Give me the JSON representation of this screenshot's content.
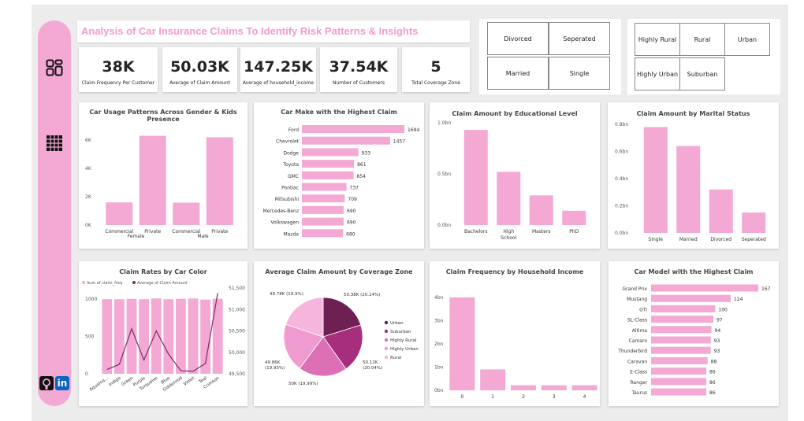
{
  "colors": {
    "accent": "#f29ccd",
    "bar": "#f4a8d4",
    "line": "#7b2b62",
    "sidebar": "#f4a8d4",
    "canvas": "#ececec"
  },
  "sidebar": {
    "icons": [
      {
        "name": "dashboard-grid-icon"
      },
      {
        "name": "table-grid-icon"
      }
    ],
    "social": [
      {
        "name": "github-icon"
      },
      {
        "name": "linkedin-icon",
        "label": "in"
      }
    ]
  },
  "header": {
    "title": "Analysis of Car Insurance  Claims To Identify Risk Patterns & Insights"
  },
  "kpis": [
    {
      "value": "38K",
      "label": "Claim Frequency Per Customer"
    },
    {
      "value": "50.03K",
      "label": "Average of Claim Amount"
    },
    {
      "value": "147.25K",
      "label": "Average of household_income"
    },
    {
      "value": "37.54K",
      "label": "Number of Customers"
    },
    {
      "value": "5",
      "label": "Total Coverage Zone"
    }
  ],
  "slicers": {
    "marital": [
      "Divorced",
      "Seperated",
      "Married",
      "Single"
    ],
    "zone": [
      "Highly Rural",
      "Rural",
      "Urban",
      "Highly Urban",
      "Suburban"
    ]
  },
  "chart_data": [
    {
      "id": "usage",
      "type": "bar",
      "title": "Car Usage Patterns Across Gender & Kids Presence",
      "categories": [
        "Commercial",
        "Private",
        "Commercial",
        "Private"
      ],
      "groups": [
        "Female",
        "Male"
      ],
      "values": [
        1600,
        6300,
        1580,
        6200
      ],
      "yticks": [
        "0K",
        "2K",
        "4K",
        "6K"
      ],
      "ylim": [
        0,
        7000
      ]
    },
    {
      "id": "make",
      "type": "bar",
      "orientation": "horizontal",
      "title": "Car Make with the Highest Claim",
      "categories": [
        "Ford",
        "Chevrolet",
        "Dodge",
        "Toyota",
        "GMC",
        "Pontiac",
        "Mitsubishi",
        "Mercedes-Benz",
        "Volkswagen",
        "Mazda"
      ],
      "values": [
        1694,
        1457,
        933,
        861,
        854,
        737,
        709,
        690,
        690,
        680
      ],
      "labels": [
        "1694",
        "1457",
        "933",
        "861",
        "854",
        "737",
        "709",
        "690",
        "690",
        "680"
      ]
    },
    {
      "id": "education",
      "type": "bar",
      "title": "Claim Amount by Educational Level",
      "categories": [
        "Bachelors",
        "High School",
        "Masters",
        "PhD"
      ],
      "values": [
        0.93,
        0.52,
        0.29,
        0.14
      ],
      "yticks": [
        "0.0bn",
        "0.5bn",
        "1.0bn"
      ],
      "ylim": [
        0,
        1.0
      ]
    },
    {
      "id": "marital",
      "type": "bar",
      "title": "Claim Amount by Marital Status",
      "categories": [
        "Single",
        "Married",
        "Divorced",
        "Seperated"
      ],
      "values": [
        0.78,
        0.64,
        0.32,
        0.15
      ],
      "yticks": [
        "0.0bn",
        "0.2bn",
        "0.4bn",
        "0.6bn",
        "0.8bn"
      ],
      "ylim": [
        0,
        0.8
      ]
    },
    {
      "id": "color",
      "type": "bar",
      "title": "Claim Rates by Car Color",
      "legend": [
        "Sum of claim_freq",
        "Average of Claim Amount"
      ],
      "categories": [
        "Aquamarine",
        "Indigo",
        "Green",
        "Purple",
        "Turquoise",
        "Blue",
        "Goldenrod",
        "Violet",
        "Teal",
        "Crimson"
      ],
      "category_labels": [
        "Aquama...",
        "Indigo",
        "Green",
        "Purple",
        "Turquoise",
        "Blue",
        "Goldenrod",
        "Violet",
        "Teal",
        "Crimson"
      ],
      "series": [
        {
          "name": "Sum of claim_freq",
          "values": [
            1000,
            1000,
            1005,
            1000,
            1010,
            1000,
            1005,
            1010,
            995,
            1005
          ]
        },
        {
          "name": "Average of Claim Amount",
          "values": [
            49600,
            49720,
            50550,
            49820,
            50500,
            49960,
            49570,
            49560,
            49740,
            51380
          ]
        }
      ],
      "yticks_left": [
        "0",
        "500",
        "1000"
      ],
      "ylim_left": [
        0,
        1150
      ],
      "yticks_right": [
        "49,500",
        "50,000",
        "50,500",
        "51,000",
        "51,500"
      ],
      "ylim_right": [
        49500,
        51500
      ]
    },
    {
      "id": "zone",
      "type": "pie",
      "title": "Average Claim Amount by Coverage Zone",
      "slices": [
        {
          "name": "Urban",
          "value": 50380,
          "label": "50.38K (20.14%)",
          "color": "#6e1f54"
        },
        {
          "name": "Suburban",
          "value": 50120,
          "label": "50.12K (20.04%)",
          "color": "#a62e7c"
        },
        {
          "name": "Highly Rural",
          "value": 50000,
          "label": "50K (19.99%)",
          "color": "#dd6fb7"
        },
        {
          "name": "Highly Urban",
          "value": 49860,
          "label": "49.86K (19.93%)",
          "color": "#f09bcf"
        },
        {
          "name": "Rural",
          "value": 49780,
          "label": "49.78K (19.9%)",
          "color": "#f6b5dc"
        }
      ]
    },
    {
      "id": "income",
      "type": "bar",
      "title": "Claim Frequency by Household Income",
      "categories": [
        "0",
        "1",
        "2",
        "3",
        "4"
      ],
      "values": [
        4.0,
        0.9,
        0.22,
        0.22,
        0.22
      ],
      "yticks": [
        "0bn",
        "1bn",
        "2bn",
        "3bn",
        "4bn"
      ],
      "ylim": [
        0,
        4.2
      ]
    },
    {
      "id": "model",
      "type": "bar",
      "orientation": "horizontal",
      "title": "Car Model with the Highest Claim",
      "categories": [
        "Grand Prix",
        "Mustang",
        "GTI",
        "SL-Class",
        "Altima",
        "Camaro",
        "Thunderbird",
        "Caravan",
        "E-Class",
        "Ranger",
        "Taurus"
      ],
      "values": [
        167,
        124,
        100,
        97,
        94,
        93,
        93,
        88,
        86,
        86,
        86
      ],
      "labels": [
        "167",
        "124",
        "100",
        "97",
        "94",
        "93",
        "93",
        "88",
        "86",
        "86",
        "86"
      ]
    }
  ]
}
